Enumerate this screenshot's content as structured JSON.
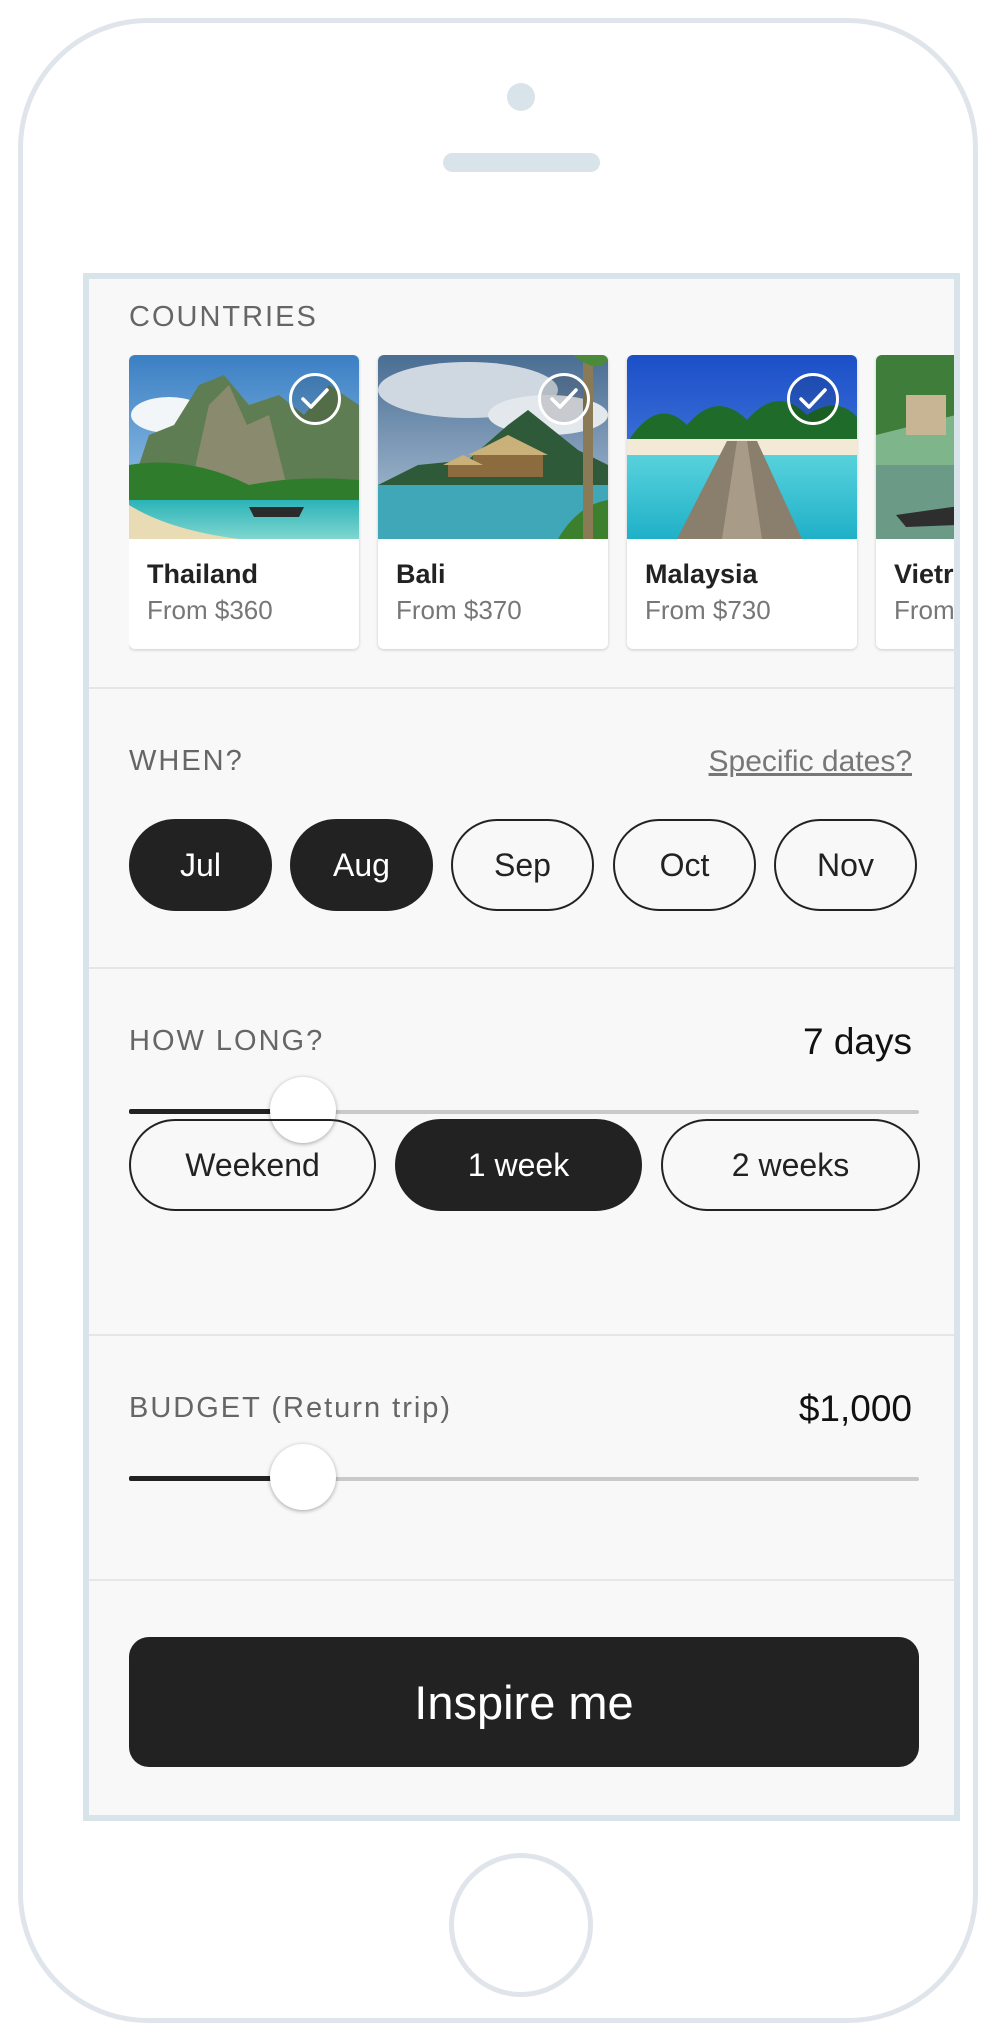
{
  "countries": {
    "title": "COUNTRIES",
    "items": [
      {
        "name": "Thailand",
        "price": "From $360",
        "selected": true
      },
      {
        "name": "Bali",
        "price": "From $370",
        "selected": true
      },
      {
        "name": "Malaysia",
        "price": "From $730",
        "selected": true
      },
      {
        "name": "Vietr",
        "price": "From",
        "selected": false
      }
    ]
  },
  "when": {
    "title": "WHEN?",
    "link": "Specific dates?",
    "months": [
      {
        "label": "Jul",
        "active": true
      },
      {
        "label": "Aug",
        "active": true
      },
      {
        "label": "Sep",
        "active": false
      },
      {
        "label": "Oct",
        "active": false
      },
      {
        "label": "Nov",
        "active": false
      }
    ]
  },
  "how_long": {
    "title": "HOW LONG?",
    "value": "7 days",
    "slider_fraction": 0.22,
    "options": [
      {
        "label": "Weekend",
        "active": false
      },
      {
        "label": "1 week",
        "active": true
      },
      {
        "label": "2 weeks",
        "active": false
      }
    ]
  },
  "budget": {
    "title": "BUDGET (Return trip)",
    "value": "$1,000",
    "slider_fraction": 0.22
  },
  "cta": {
    "label": "Inspire me"
  },
  "colors": {
    "primary": "#222222",
    "muted": "#777777",
    "background": "#f8f8f8"
  }
}
